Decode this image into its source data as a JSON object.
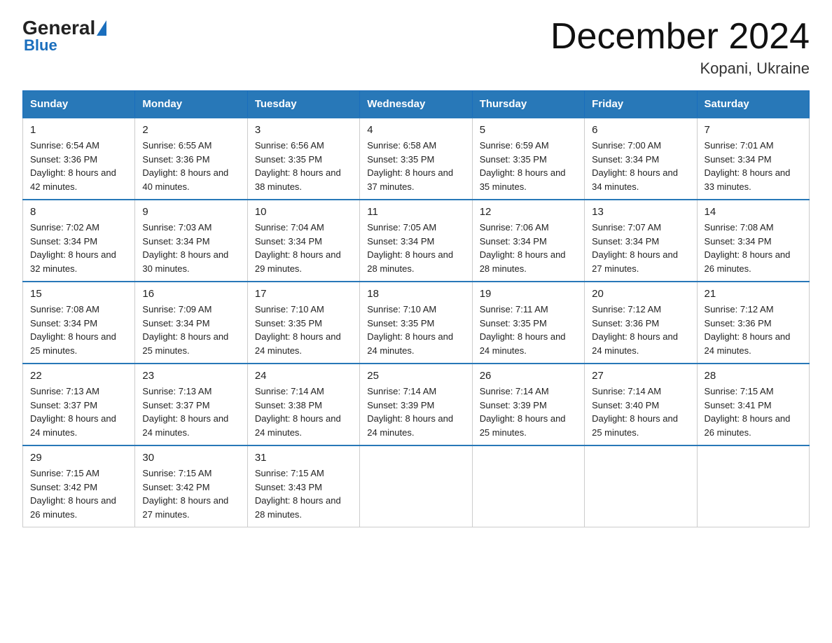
{
  "header": {
    "logo_general": "General",
    "logo_blue": "Blue",
    "title": "December 2024",
    "subtitle": "Kopani, Ukraine"
  },
  "days_of_week": [
    "Sunday",
    "Monday",
    "Tuesday",
    "Wednesday",
    "Thursday",
    "Friday",
    "Saturday"
  ],
  "weeks": [
    [
      {
        "day": "1",
        "sunrise": "6:54 AM",
        "sunset": "3:36 PM",
        "daylight": "8 hours and 42 minutes."
      },
      {
        "day": "2",
        "sunrise": "6:55 AM",
        "sunset": "3:36 PM",
        "daylight": "8 hours and 40 minutes."
      },
      {
        "day": "3",
        "sunrise": "6:56 AM",
        "sunset": "3:35 PM",
        "daylight": "8 hours and 38 minutes."
      },
      {
        "day": "4",
        "sunrise": "6:58 AM",
        "sunset": "3:35 PM",
        "daylight": "8 hours and 37 minutes."
      },
      {
        "day": "5",
        "sunrise": "6:59 AM",
        "sunset": "3:35 PM",
        "daylight": "8 hours and 35 minutes."
      },
      {
        "day": "6",
        "sunrise": "7:00 AM",
        "sunset": "3:34 PM",
        "daylight": "8 hours and 34 minutes."
      },
      {
        "day": "7",
        "sunrise": "7:01 AM",
        "sunset": "3:34 PM",
        "daylight": "8 hours and 33 minutes."
      }
    ],
    [
      {
        "day": "8",
        "sunrise": "7:02 AM",
        "sunset": "3:34 PM",
        "daylight": "8 hours and 32 minutes."
      },
      {
        "day": "9",
        "sunrise": "7:03 AM",
        "sunset": "3:34 PM",
        "daylight": "8 hours and 30 minutes."
      },
      {
        "day": "10",
        "sunrise": "7:04 AM",
        "sunset": "3:34 PM",
        "daylight": "8 hours and 29 minutes."
      },
      {
        "day": "11",
        "sunrise": "7:05 AM",
        "sunset": "3:34 PM",
        "daylight": "8 hours and 28 minutes."
      },
      {
        "day": "12",
        "sunrise": "7:06 AM",
        "sunset": "3:34 PM",
        "daylight": "8 hours and 28 minutes."
      },
      {
        "day": "13",
        "sunrise": "7:07 AM",
        "sunset": "3:34 PM",
        "daylight": "8 hours and 27 minutes."
      },
      {
        "day": "14",
        "sunrise": "7:08 AM",
        "sunset": "3:34 PM",
        "daylight": "8 hours and 26 minutes."
      }
    ],
    [
      {
        "day": "15",
        "sunrise": "7:08 AM",
        "sunset": "3:34 PM",
        "daylight": "8 hours and 25 minutes."
      },
      {
        "day": "16",
        "sunrise": "7:09 AM",
        "sunset": "3:34 PM",
        "daylight": "8 hours and 25 minutes."
      },
      {
        "day": "17",
        "sunrise": "7:10 AM",
        "sunset": "3:35 PM",
        "daylight": "8 hours and 24 minutes."
      },
      {
        "day": "18",
        "sunrise": "7:10 AM",
        "sunset": "3:35 PM",
        "daylight": "8 hours and 24 minutes."
      },
      {
        "day": "19",
        "sunrise": "7:11 AM",
        "sunset": "3:35 PM",
        "daylight": "8 hours and 24 minutes."
      },
      {
        "day": "20",
        "sunrise": "7:12 AM",
        "sunset": "3:36 PM",
        "daylight": "8 hours and 24 minutes."
      },
      {
        "day": "21",
        "sunrise": "7:12 AM",
        "sunset": "3:36 PM",
        "daylight": "8 hours and 24 minutes."
      }
    ],
    [
      {
        "day": "22",
        "sunrise": "7:13 AM",
        "sunset": "3:37 PM",
        "daylight": "8 hours and 24 minutes."
      },
      {
        "day": "23",
        "sunrise": "7:13 AM",
        "sunset": "3:37 PM",
        "daylight": "8 hours and 24 minutes."
      },
      {
        "day": "24",
        "sunrise": "7:14 AM",
        "sunset": "3:38 PM",
        "daylight": "8 hours and 24 minutes."
      },
      {
        "day": "25",
        "sunrise": "7:14 AM",
        "sunset": "3:39 PM",
        "daylight": "8 hours and 24 minutes."
      },
      {
        "day": "26",
        "sunrise": "7:14 AM",
        "sunset": "3:39 PM",
        "daylight": "8 hours and 25 minutes."
      },
      {
        "day": "27",
        "sunrise": "7:14 AM",
        "sunset": "3:40 PM",
        "daylight": "8 hours and 25 minutes."
      },
      {
        "day": "28",
        "sunrise": "7:15 AM",
        "sunset": "3:41 PM",
        "daylight": "8 hours and 26 minutes."
      }
    ],
    [
      {
        "day": "29",
        "sunrise": "7:15 AM",
        "sunset": "3:42 PM",
        "daylight": "8 hours and 26 minutes."
      },
      {
        "day": "30",
        "sunrise": "7:15 AM",
        "sunset": "3:42 PM",
        "daylight": "8 hours and 27 minutes."
      },
      {
        "day": "31",
        "sunrise": "7:15 AM",
        "sunset": "3:43 PM",
        "daylight": "8 hours and 28 minutes."
      },
      null,
      null,
      null,
      null
    ]
  ]
}
